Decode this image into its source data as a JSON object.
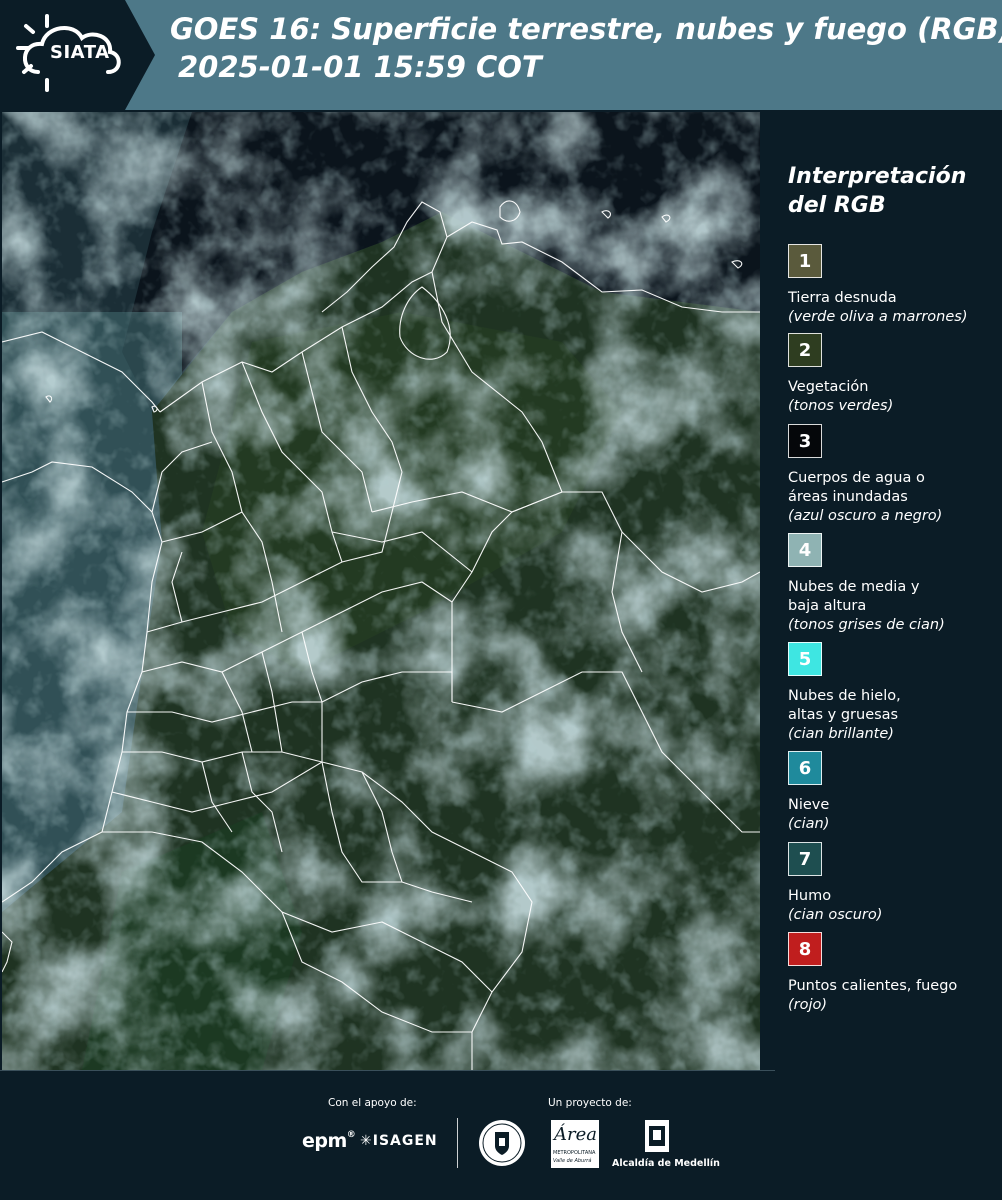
{
  "header": {
    "logo_text": "SIATA",
    "title_line1": "GOES 16: Superficie terrestre, nubes y fuego (RGB)",
    "title_line2": "2025-01-01 15:59 COT"
  },
  "legend": {
    "title": "Interpretación del RGB",
    "items": [
      {
        "num": "1",
        "label": "Tierra desnuda",
        "desc": "(verde oliva a marrones)",
        "color": "#5a5a3c"
      },
      {
        "num": "2",
        "label": "Vegetación",
        "desc": "(tonos verdes)",
        "color": "#2e3d20"
      },
      {
        "num": "3",
        "label": "Cuerpos de agua o\náreas inundadas",
        "desc": "(azul oscuro a negro)",
        "color": "#05070a"
      },
      {
        "num": "4",
        "label": "Nubes de media y\nbaja altura",
        "desc": "(tonos grises de cian)",
        "color": "#8fb3b3"
      },
      {
        "num": "5",
        "label": "Nubes de hielo,\naltas y gruesas",
        "desc": "(cian brillante)",
        "color": "#3ee6e2"
      },
      {
        "num": "6",
        "label": "Nieve",
        "desc": "(cian)",
        "color": "#1f8a9c"
      },
      {
        "num": "7",
        "label": "Humo",
        "desc": "(cian oscuro)",
        "color": "#1e4e50"
      },
      {
        "num": "8",
        "label": "Puntos calientes, fuego",
        "desc": "(rojo)",
        "color": "#c01e1e"
      }
    ]
  },
  "footer": {
    "support_label": "Con el apoyo de:",
    "project_label": "Un proyecto de:",
    "epm": "epm",
    "isagen": "ISAGEN",
    "area_metro_1": "METROPOLITANA",
    "area_metro_2": "Valle de Aburrá",
    "alcaldia": "Alcaldía de Medellín"
  }
}
